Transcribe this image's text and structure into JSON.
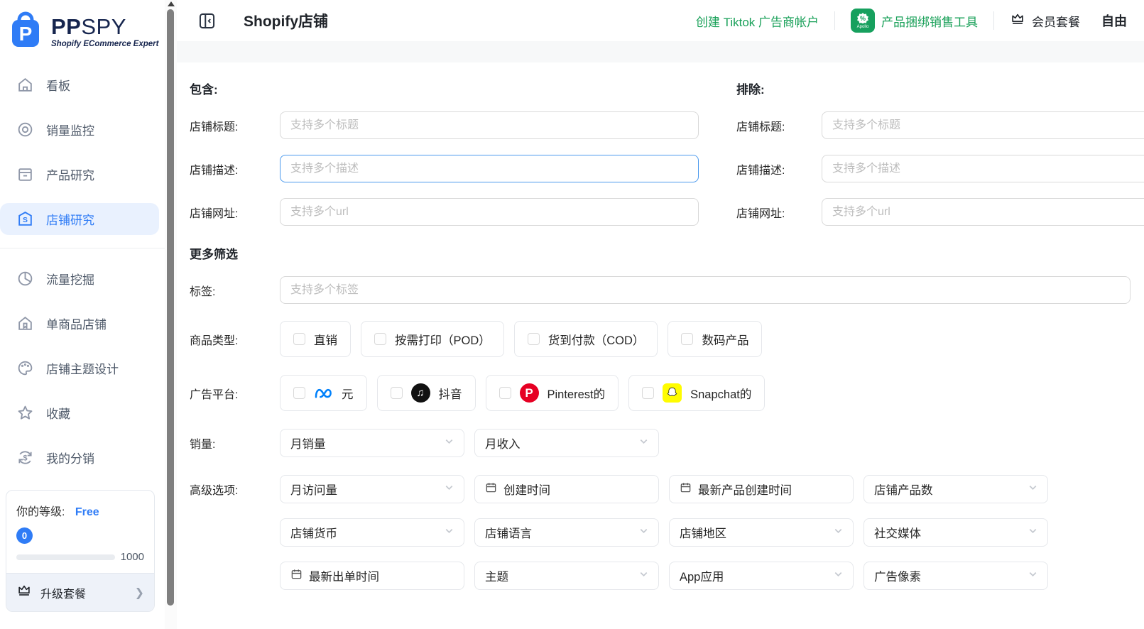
{
  "brand": {
    "name_bold": "PP",
    "name_light": "SPY",
    "tagline": "Shopify ECommerce Expert"
  },
  "sidebar": {
    "items": [
      {
        "label": "看板"
      },
      {
        "label": "销量监控"
      },
      {
        "label": "产品研究"
      },
      {
        "label": "店铺研究"
      },
      {
        "label": "流量挖掘"
      },
      {
        "label": "单商品店铺"
      },
      {
        "label": "店铺主题设计"
      },
      {
        "label": "收藏"
      },
      {
        "label": "我的分销"
      }
    ],
    "level": {
      "label": "你的等级:",
      "value": "Free",
      "current": "0",
      "max": "1000"
    },
    "upgrade_label": "升级套餐"
  },
  "header": {
    "title": "Shopify店铺",
    "tiktok_link": "创建 Tiktok 广告商帐户",
    "apollo_pct": "%",
    "apollo_name": "Apollo",
    "bundle_link": "产品捆绑销售工具",
    "member_link": "会员套餐",
    "user": "自由"
  },
  "colors": {
    "accent_blue": "#2f7cf6",
    "green": "#18a058",
    "pinterest_red": "#e60023",
    "snapchat_yellow": "#fffc00",
    "meta_blue": "#0081fb"
  },
  "filters": {
    "include": {
      "title": "包含:",
      "rows": [
        {
          "label": "店铺标题:",
          "placeholder": "支持多个标题"
        },
        {
          "label": "店铺描述:",
          "placeholder": "支持多个描述"
        },
        {
          "label": "店铺网址:",
          "placeholder": "支持多个url"
        }
      ]
    },
    "exclude": {
      "title": "排除:",
      "rows": [
        {
          "label": "店铺标题:",
          "placeholder": "支持多个标题"
        },
        {
          "label": "店铺描述:",
          "placeholder": "支持多个描述"
        },
        {
          "label": "店铺网址:",
          "placeholder": "支持多个url"
        }
      ]
    },
    "more_title": "更多筛选",
    "tags": {
      "label": "标签:",
      "placeholder": "支持多个标签"
    },
    "product_type": {
      "label": "商品类型:",
      "options": [
        "直销",
        "按需打印（POD）",
        "货到付款（COD）",
        "数码产品"
      ]
    },
    "ad_platform": {
      "label": "广告平台:",
      "options": [
        {
          "icon": "meta-icon",
          "label": "元"
        },
        {
          "icon": "tiktok-icon",
          "label": "抖音"
        },
        {
          "icon": "pinterest-icon",
          "label": "Pinterest的"
        },
        {
          "icon": "snapchat-icon",
          "label": "Snapchat的"
        }
      ]
    },
    "sales": {
      "label": "销量:",
      "selects": [
        "月销量",
        "月收入"
      ]
    },
    "advanced": {
      "label": "高级选项:",
      "rows": [
        [
          {
            "type": "select",
            "label": "月访问量"
          },
          {
            "type": "date",
            "label": "创建时间"
          },
          {
            "type": "date",
            "label": "最新产品创建时间"
          },
          {
            "type": "select",
            "label": "店铺产品数"
          }
        ],
        [
          {
            "type": "select",
            "label": "店铺货币"
          },
          {
            "type": "select",
            "label": "店铺语言"
          },
          {
            "type": "select",
            "label": "店铺地区"
          },
          {
            "type": "select",
            "label": "社交媒体"
          }
        ],
        [
          {
            "type": "date",
            "label": "最新出单时间"
          },
          {
            "type": "select",
            "label": "主题"
          },
          {
            "type": "select",
            "label": "App应用"
          },
          {
            "type": "select",
            "label": "广告像素"
          }
        ]
      ]
    }
  }
}
